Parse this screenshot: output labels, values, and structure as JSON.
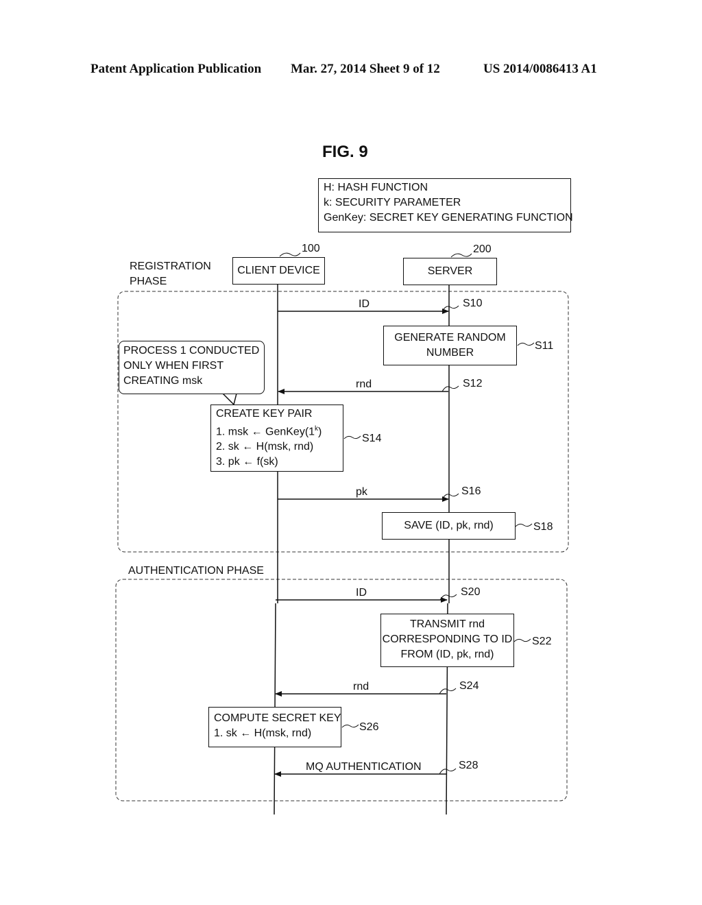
{
  "header": {
    "publication": "Patent Application Publication",
    "date_sheet": "Mar. 27, 2014  Sheet 9 of 12",
    "number": "US 2014/0086413 A1"
  },
  "figure_title": "FIG. 9",
  "legend": {
    "lines": [
      "H: HASH FUNCTION",
      "k: SECURITY PARAMETER",
      "GenKey: SECRET KEY GENERATING FUNCTION"
    ]
  },
  "actors": {
    "client": {
      "label": "CLIENT DEVICE",
      "ref": "100"
    },
    "server": {
      "label": "SERVER",
      "ref": "200"
    }
  },
  "phases": {
    "registration": {
      "label_line1": "REGISTRATION",
      "label_line2": "PHASE"
    },
    "authentication": {
      "label": "AUTHENTICATION PHASE"
    }
  },
  "note": {
    "lines": [
      "PROCESS 1 CONDUCTED",
      "ONLY WHEN FIRST",
      "CREATING msk"
    ]
  },
  "steps": {
    "s10": {
      "label": "S10",
      "message": "ID"
    },
    "s11": {
      "label": "S11",
      "lines": [
        "GENERATE RANDOM",
        "NUMBER"
      ]
    },
    "s12": {
      "label": "S12",
      "message": "rnd"
    },
    "s14": {
      "label": "S14",
      "title": "CREATE KEY PAIR",
      "line1_pre": "1. msk ← GenKey(1",
      "line1_sup": "k",
      "line1_post": ")",
      "line2": "2. sk ← H(msk, rnd)",
      "line3": "3. pk ← f(sk)"
    },
    "s16": {
      "label": "S16",
      "message": "pk"
    },
    "s18": {
      "label": "S18",
      "text": "SAVE (ID, pk, rnd)"
    },
    "s20": {
      "label": "S20",
      "message": "ID"
    },
    "s22": {
      "label": "S22",
      "lines": [
        "TRANSMIT rnd",
        "CORRESPONDING TO ID",
        "FROM (ID, pk, rnd)"
      ]
    },
    "s24": {
      "label": "S24",
      "message": "rnd"
    },
    "s26": {
      "label": "S26",
      "lines": [
        "COMPUTE SECRET KEY",
        "1. sk ← H(msk, rnd)"
      ]
    },
    "s28": {
      "label": "S28",
      "message": "MQ AUTHENTICATION"
    }
  }
}
